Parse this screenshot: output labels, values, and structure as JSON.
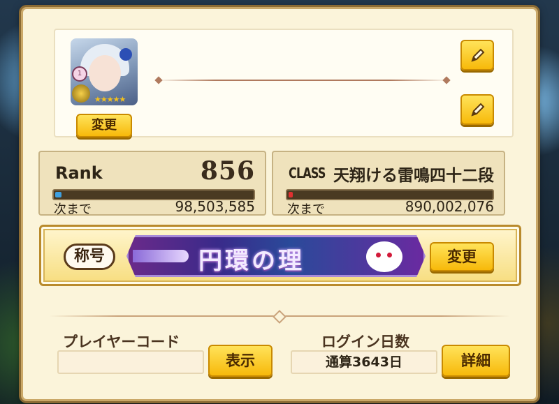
{
  "profile": {
    "change_avatar_label": "変更",
    "avatar_level": "1",
    "avatar_stars": "★★★★★"
  },
  "rank": {
    "label": "Rank",
    "value": "856",
    "progress": 0.03,
    "next_label": "次まで",
    "next_value": "98,503,585",
    "bar_color": "#3fa0e0"
  },
  "class": {
    "label": "CLASS",
    "name": "天翔ける雷鳴四十二段",
    "progress": 0.02,
    "next_label": "次まで",
    "next_value": "890,002,076",
    "bar_color": "#e03030"
  },
  "title_section": {
    "tag": "称号",
    "banner_text": "円環の理",
    "change_label": "変更"
  },
  "player_code": {
    "label": "プレイヤーコード",
    "value": "",
    "show_label": "表示"
  },
  "login_days": {
    "label": "ログイン日数",
    "value": "通算3643日",
    "detail_label": "詳細"
  },
  "icons": {
    "edit": "pencil-icon",
    "avatar": "character-portrait"
  }
}
